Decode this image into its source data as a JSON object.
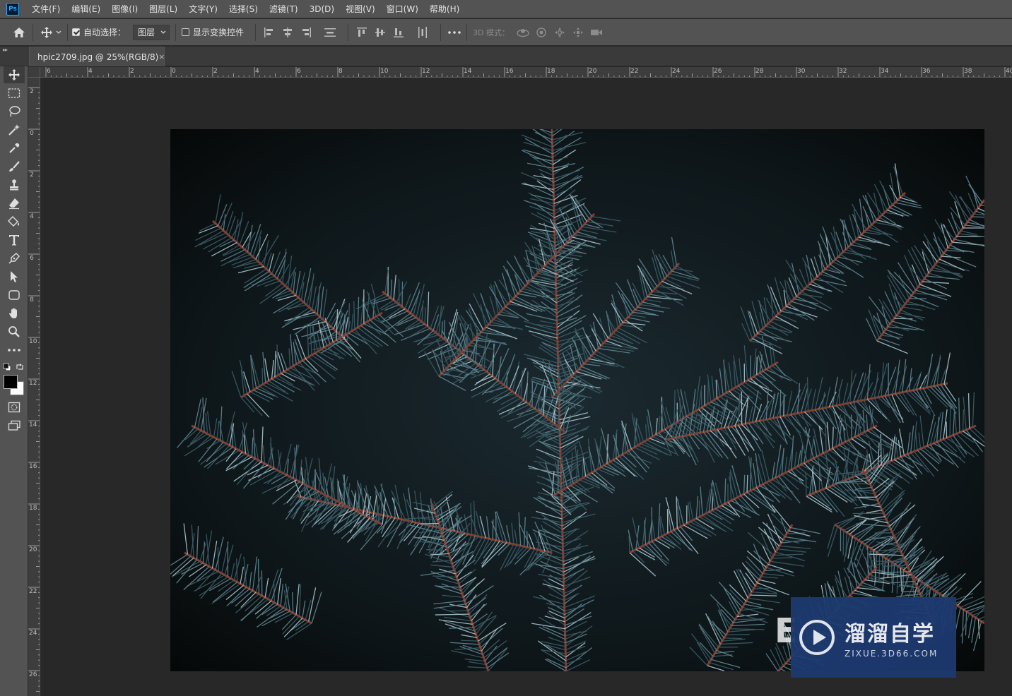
{
  "app": {
    "logo": "Ps"
  },
  "menu": {
    "items": [
      "文件(F)",
      "编辑(E)",
      "图像(I)",
      "图层(L)",
      "文字(Y)",
      "选择(S)",
      "滤镜(T)",
      "3D(D)",
      "视图(V)",
      "窗口(W)",
      "帮助(H)"
    ]
  },
  "options": {
    "auto_select_label": "自动选择：",
    "auto_select_checked": true,
    "layer_select_value": "图层",
    "show_transform_label": "显示变换控件",
    "show_transform_checked": false,
    "mode_3d_label": "3D 模式："
  },
  "document": {
    "tab_title": "hpic2709.jpg @ 25%(RGB/8)",
    "close_glyph": "×"
  },
  "ruler": {
    "top_labels": [
      "6",
      "4",
      "2",
      "0",
      "2",
      "4",
      "6",
      "8",
      "10",
      "12",
      "14",
      "16",
      "18",
      "20",
      "22",
      "24",
      "26",
      "28",
      "30",
      "32",
      "34",
      "36",
      "38",
      "40"
    ],
    "left_labels": [
      "2",
      "0",
      "2",
      "4",
      "6",
      "8",
      "10",
      "12",
      "14",
      "16",
      "18",
      "20",
      "22",
      "24",
      "26"
    ]
  },
  "watermark": {
    "title": "溜溜自学",
    "url": "ZIXUE.3D66.COM"
  },
  "colors": {
    "menu_bg": "#535353",
    "canvas_bg": "#282828",
    "accent": "#31a8ff",
    "watermark_bg": "#1d3a70"
  }
}
